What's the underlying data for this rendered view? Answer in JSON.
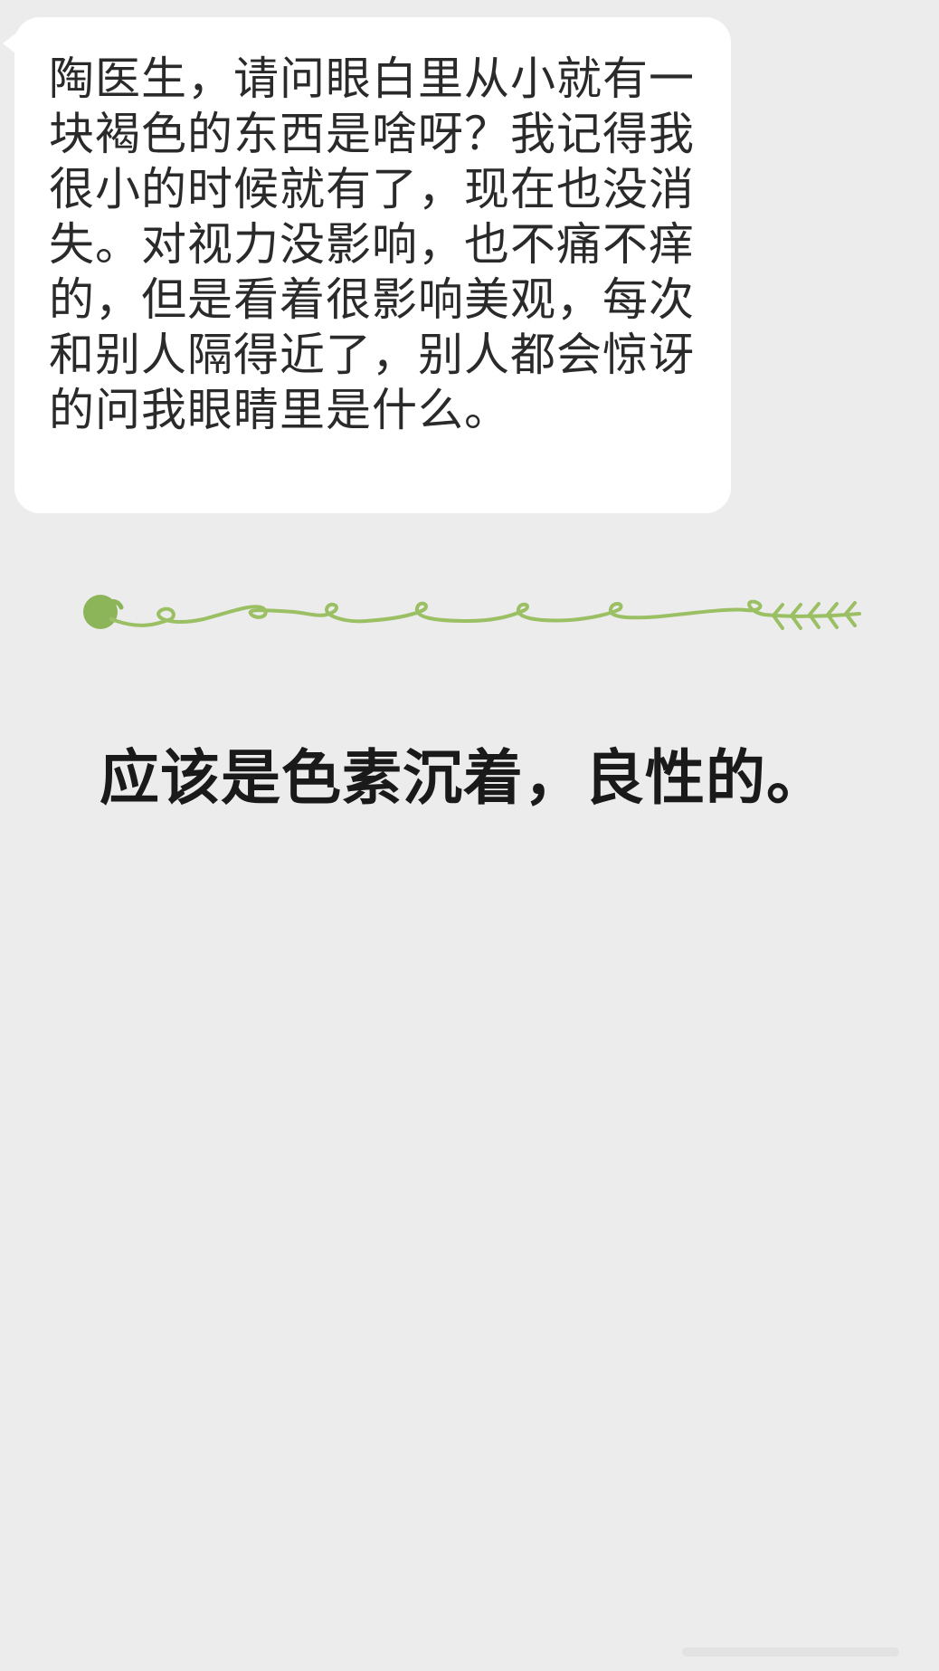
{
  "conversation": {
    "question": "陶医生，请问眼白里从小就有一块褐色的东西是啥呀？我记得我很小的时候就有了，现在也没消失。对视力没影响，也不痛不痒的，但是看着很影响美观，每次和别人隔得近了，别人都会惊讶的问我眼睛里是什么。",
    "answer": "应该是色素沉着，良性的。"
  },
  "colors": {
    "background": "#ececec",
    "bubble": "#ffffff",
    "divider_green": "#9bbf63",
    "leaf_green": "#8cb55a"
  },
  "icons": {
    "divider": "vine-divider-icon"
  }
}
